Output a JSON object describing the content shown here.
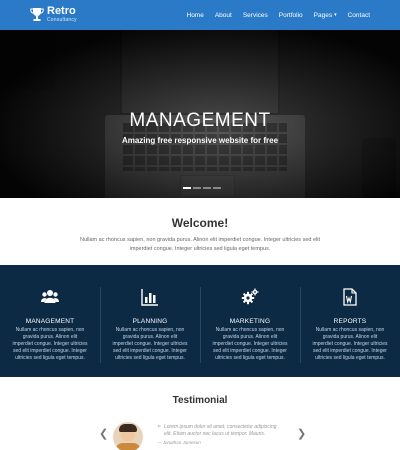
{
  "brand": {
    "title": "Retro",
    "subtitle": "Consultancy"
  },
  "nav": {
    "items": [
      {
        "label": "Home"
      },
      {
        "label": "About"
      },
      {
        "label": "Services"
      },
      {
        "label": "Portfolio"
      },
      {
        "label": "Pages",
        "dropdown": true
      },
      {
        "label": "Contact"
      }
    ]
  },
  "hero": {
    "title": "MANAGEMENT",
    "subtitle": "Amazing free responsive website for free",
    "slides": 4,
    "active_slide": 1
  },
  "welcome": {
    "title": "Welcome!",
    "text": "Nullam ac rhoncus sapien, non gravida purus. Alinon elit imperdiet congue. Integer ultricies sed elit imperdiet congue. Integer ultricies sed ligula eget tempus."
  },
  "services": [
    {
      "icon": "users-icon",
      "title": "MANAGEMENT",
      "text": "Nullam ac rhoncus sapien, non gravida purus. Alinon elit imperdiet congue. Integer ultricies sed elit imperdiet congue. Integer ultricies sed ligula eget tempus."
    },
    {
      "icon": "bar-chart-icon",
      "title": "PLANNING",
      "text": "Nullam ac rhoncus sapien, non gravida purus. Alinon elit imperdiet congue. Integer ultricies sed elit imperdiet congue. Integer ultricies sed ligula eget tempus."
    },
    {
      "icon": "gears-icon",
      "title": "MARKETING",
      "text": "Nullam ac rhoncus sapien, non gravida purus. Alinon elit imperdiet congue. Integer ultricies sed elit imperdiet congue. Integer ultricies sed ligula eget tempus."
    },
    {
      "icon": "document-icon",
      "title": "REPORTS",
      "text": "Nullam ac rhoncus sapien, non gravida purus. Alinon elit imperdiet congue. Integer ultricies sed elit imperdiet congue. Integer ultricies sed ligula eget tempus."
    }
  ],
  "testimonial": {
    "title": "Testimonial",
    "quote": "Lorem ipsum dolor sit amet, consectetur adipiscing elit. Etiam auctor nec lacus ut tempor. Mauris.",
    "author": "— Jonathan Jameson",
    "prev_icon": "chevron-left-icon",
    "next_icon": "chevron-right-icon"
  },
  "colors": {
    "header": "#2a7ac7",
    "services_bg": "#0d2a45",
    "hero_bg": "#1b1b1b"
  }
}
